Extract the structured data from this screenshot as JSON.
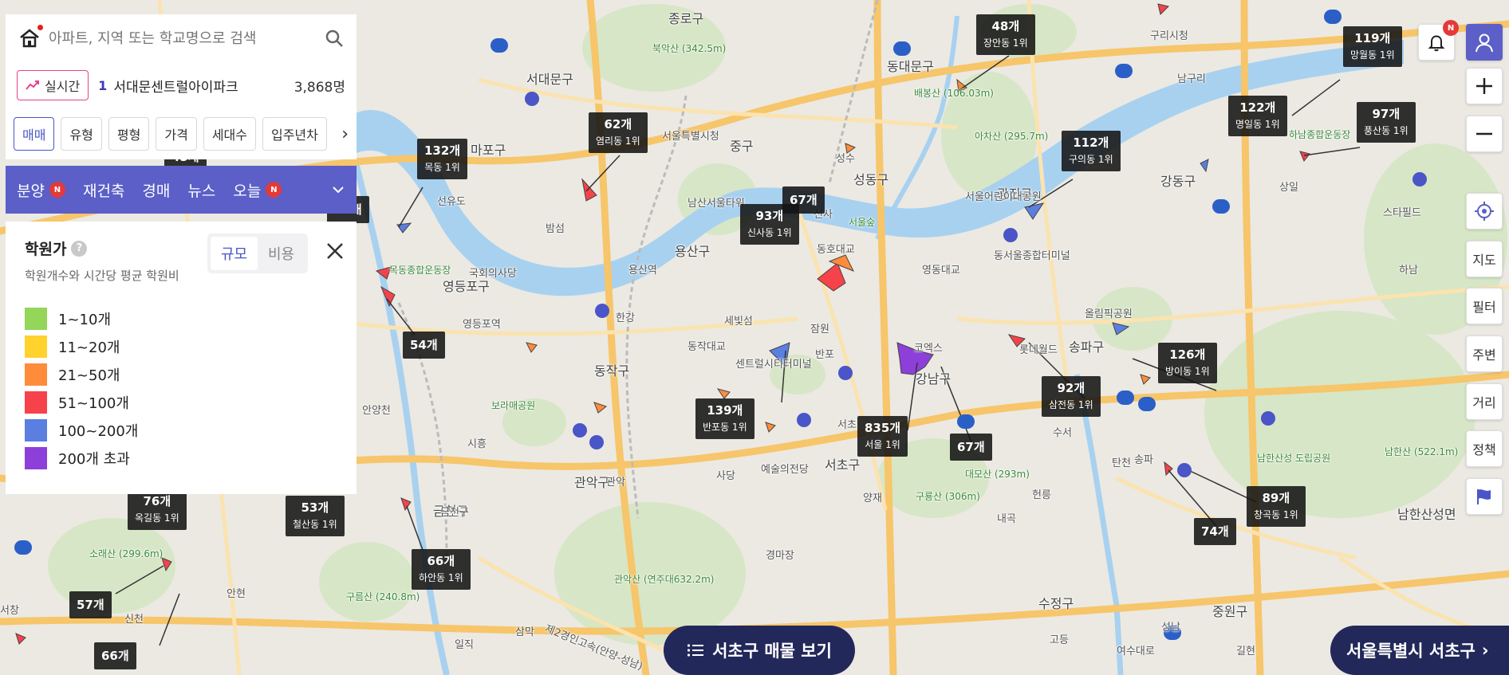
{
  "search": {
    "placeholder": "아파트, 지역 또는 학교명으로 검색"
  },
  "realtime": {
    "label": "실시간",
    "rank": "1",
    "name": "서대문센트럴아이파크",
    "count": "3,868명"
  },
  "filters": [
    "매매",
    "유형",
    "평형",
    "가격",
    "세대수",
    "입주년차"
  ],
  "categories": [
    {
      "label": "분양",
      "badge": "N"
    },
    {
      "label": "재건축",
      "badge": ""
    },
    {
      "label": "경매",
      "badge": ""
    },
    {
      "label": "뉴스",
      "badge": ""
    },
    {
      "label": "오늘",
      "badge": "N"
    }
  ],
  "legend": {
    "title": "학원가",
    "help": "?",
    "subtitle": "학원개수와 시간당 평균 학원비",
    "toggle_on": "규모",
    "toggle_off": "비용",
    "items": [
      {
        "label": "1~10개",
        "color": "#93d65a"
      },
      {
        "label": "11~20개",
        "color": "#ffd22e"
      },
      {
        "label": "21~50개",
        "color": "#ff8c3a"
      },
      {
        "label": "51~100개",
        "color": "#f5424b"
      },
      {
        "label": "100~200개",
        "color": "#5a7fe0"
      },
      {
        "label": "200개 초과",
        "color": "#8d3fd9"
      }
    ]
  },
  "markers": [
    {
      "count": "48개",
      "rank": "장안동 1위"
    },
    {
      "count": "119개",
      "rank": "망월동 1위"
    },
    {
      "count": "62개",
      "rank": "염리동 1위"
    },
    {
      "count": "132개",
      "rank": "목동 1위"
    },
    {
      "count": "122개",
      "rank": "명일동 1위"
    },
    {
      "count": "97개",
      "rank": "풍산동 1위"
    },
    {
      "count": "112개",
      "rank": "구의동 1위"
    },
    {
      "count": "93개",
      "rank": "신사동 1위"
    },
    {
      "count": "67개",
      "rank": ""
    },
    {
      "count": "54개",
      "rank": ""
    },
    {
      "count": "126개",
      "rank": "방이동 1위"
    },
    {
      "count": "92개",
      "rank": "삼전동 1위"
    },
    {
      "count": "139개",
      "rank": "반포동 1위"
    },
    {
      "count": "835개",
      "rank": "서울 1위"
    },
    {
      "count": "67개",
      "rank": ""
    },
    {
      "count": "76개",
      "rank": "옥길동 1위"
    },
    {
      "count": "53개",
      "rank": "철산동 1위"
    },
    {
      "count": "89개",
      "rank": "창곡동 1위"
    },
    {
      "count": "74개",
      "rank": ""
    },
    {
      "count": "66개",
      "rank": "하안동 1위"
    },
    {
      "count": "57개",
      "rank": ""
    },
    {
      "count": "66개",
      "rank": ""
    },
    {
      "count": "65개",
      "rank": ""
    },
    {
      "count": "45개",
      "rank": ""
    }
  ],
  "map_labels": {
    "districts": [
      "종로구",
      "서대문구",
      "동대문구",
      "중구",
      "마포구",
      "성동구",
      "광진구",
      "강동구",
      "용산구",
      "영등포구",
      "동작구",
      "서초구",
      "강남구",
      "송파구",
      "관악구",
      "금천구",
      "수정구",
      "중원구",
      "남한산성면"
    ],
    "places": [
      "북악산 (342.5m)",
      "배봉산 (106.03m)",
      "아차산 (295.7m)",
      "남산서울타워",
      "서울숲",
      "국회의사당",
      "목동종합운동장",
      "하남종합운동장",
      "올림픽공원",
      "롯데월드",
      "코엑스",
      "보라매공원",
      "예술의전당",
      "구룡산 (306m)",
      "대모산 (293m)",
      "관악산 (연주대632.2m)",
      "남한산성 도립공원",
      "남한산 (522.1m)",
      "소래산 (299.6m)",
      "구름산 (240.8m)",
      "서울특별시청",
      "동서울종합터미널",
      "서울어린이대공원",
      "센트럴시티터미널",
      "스타필드"
    ],
    "roads": [
      "선유도",
      "밤섬",
      "영동대교",
      "동호대교",
      "한강",
      "세빛섬",
      "반포",
      "잠원",
      "영등포역",
      "용산역",
      "동작대교",
      "신사",
      "성수",
      "구리시청",
      "남구리",
      "하남",
      "상일",
      "안양천",
      "시흥",
      "신천",
      "안현",
      "삼막",
      "일직",
      "제2경인고속(안양-성남)",
      "광명",
      "서창",
      "경마장",
      "양재",
      "내곡",
      "헌릉",
      "고등",
      "성남",
      "여수대로",
      "길현",
      "송파",
      "탄천",
      "수서",
      "서초",
      "사당",
      "관악",
      "금천구"
    ]
  },
  "right_controls": {
    "bell_badge": "N",
    "tools": [
      "지도",
      "필터",
      "주변",
      "거리",
      "정책"
    ]
  },
  "bottom": {
    "view_list": "서초구 매물 보기",
    "region": "서울특별시 서초구"
  }
}
